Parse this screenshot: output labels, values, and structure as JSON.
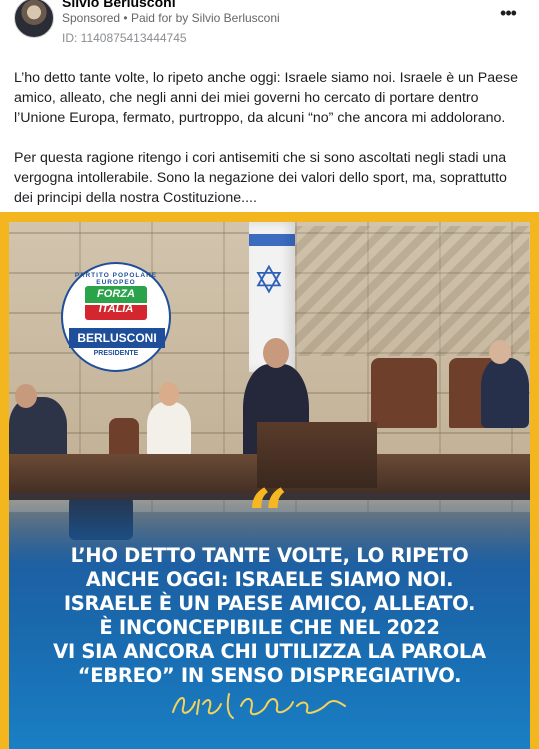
{
  "header": {
    "page_name": "Silvio Berlusconi",
    "sponsored": "Sponsored",
    "separator": "•",
    "paid_for_prefix": "Paid for by",
    "paid_for_name": "Silvio Berlusconi",
    "ad_id": "ID: 1140875413444745",
    "more_label": "•••"
  },
  "post": {
    "paragraphs": [
      "L’ho detto tante volte, lo ripeto anche oggi: Israele siamo noi. Israele è un Paese amico, alleato, che negli anni dei miei governi ho cercato di portare dentro l’Unione Europa, fermato, purtroppo, da alcuni “no” che ancora mi addolorano.",
      "Per questa ragione ritengo i cori antisemiti che si sono ascoltati negli stadi una vergogna intollerabile. Sono la negazione dei valori dello sport, ma, soprattutto dei principi della nostra Costituzione...."
    ]
  },
  "creative": {
    "logo": {
      "ring_text": "PARTITO POPOLARE EUROPEO",
      "word1": "FORZA",
      "word2": "ITALIA",
      "name": "BERLUSCONI",
      "role": "PRESIDENTE"
    },
    "quote_mark": "“",
    "quote_lines": [
      "L’HO DETTO TANTE VOLTE, LO RIPETO",
      "ANCHE OGGI: ISRAELE SIAMO NOI.",
      "ISRAELE È UN PAESE AMICO, ALLEATO.",
      "È INCONCEPIBILE CHE NEL 2022",
      "VI SIA ANCORA CHI UTILIZZA LA PAROLA",
      "“EBREO” IN SENSO DISPREGIATIVO."
    ],
    "signature_text": "Silvio Berlusconi",
    "colors": {
      "frame": "#f4b61f",
      "panel_blue": "#1a7fc4",
      "quote_accent": "#f5b820",
      "logo_blue": "#1f4f9a"
    }
  }
}
